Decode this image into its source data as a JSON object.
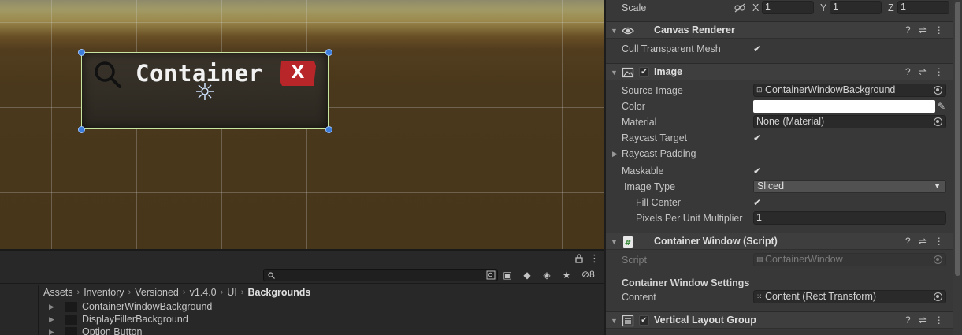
{
  "scene": {
    "widget_title": "Container",
    "widget_close_label": "X",
    "colors": {
      "widget_close": "#b8262a",
      "selection_outline": "#c8e6a0",
      "handle": "#3d7ddb"
    }
  },
  "project": {
    "hidden_count": "8",
    "breadcrumb": [
      "Assets",
      "Inventory",
      "Versioned",
      "v1.4.0",
      "UI",
      "Backgrounds"
    ],
    "files": [
      "ContainerWindowBackground",
      "DisplayFillerBackground",
      "Option Button"
    ]
  },
  "inspector": {
    "scale": {
      "label": "Scale",
      "x_label": "X",
      "x": "1",
      "y_label": "Y",
      "y": "1",
      "z_label": "Z",
      "z": "1"
    },
    "canvas_renderer": {
      "title": "Canvas Renderer",
      "cull_label": "Cull Transparent Mesh"
    },
    "image": {
      "title": "Image",
      "source_image_label": "Source Image",
      "source_image": "ContainerWindowBackground",
      "color_label": "Color",
      "color_value": "#ffffff",
      "material_label": "Material",
      "material": "None (Material)",
      "raycast_target_label": "Raycast Target",
      "raycast_padding_label": "Raycast Padding",
      "maskable_label": "Maskable",
      "image_type_label": "Image Type",
      "image_type": "Sliced",
      "fill_center_label": "Fill Center",
      "ppu_label": "Pixels Per Unit Multiplier",
      "ppu": "1"
    },
    "container_window": {
      "title": "Container Window (Script)",
      "script_label": "Script",
      "script": "ContainerWindow",
      "settings_label": "Container Window Settings",
      "content_label": "Content",
      "content": "Content (Rect Transform)"
    },
    "vertical_layout": {
      "title": "Vertical Layout Group"
    }
  }
}
